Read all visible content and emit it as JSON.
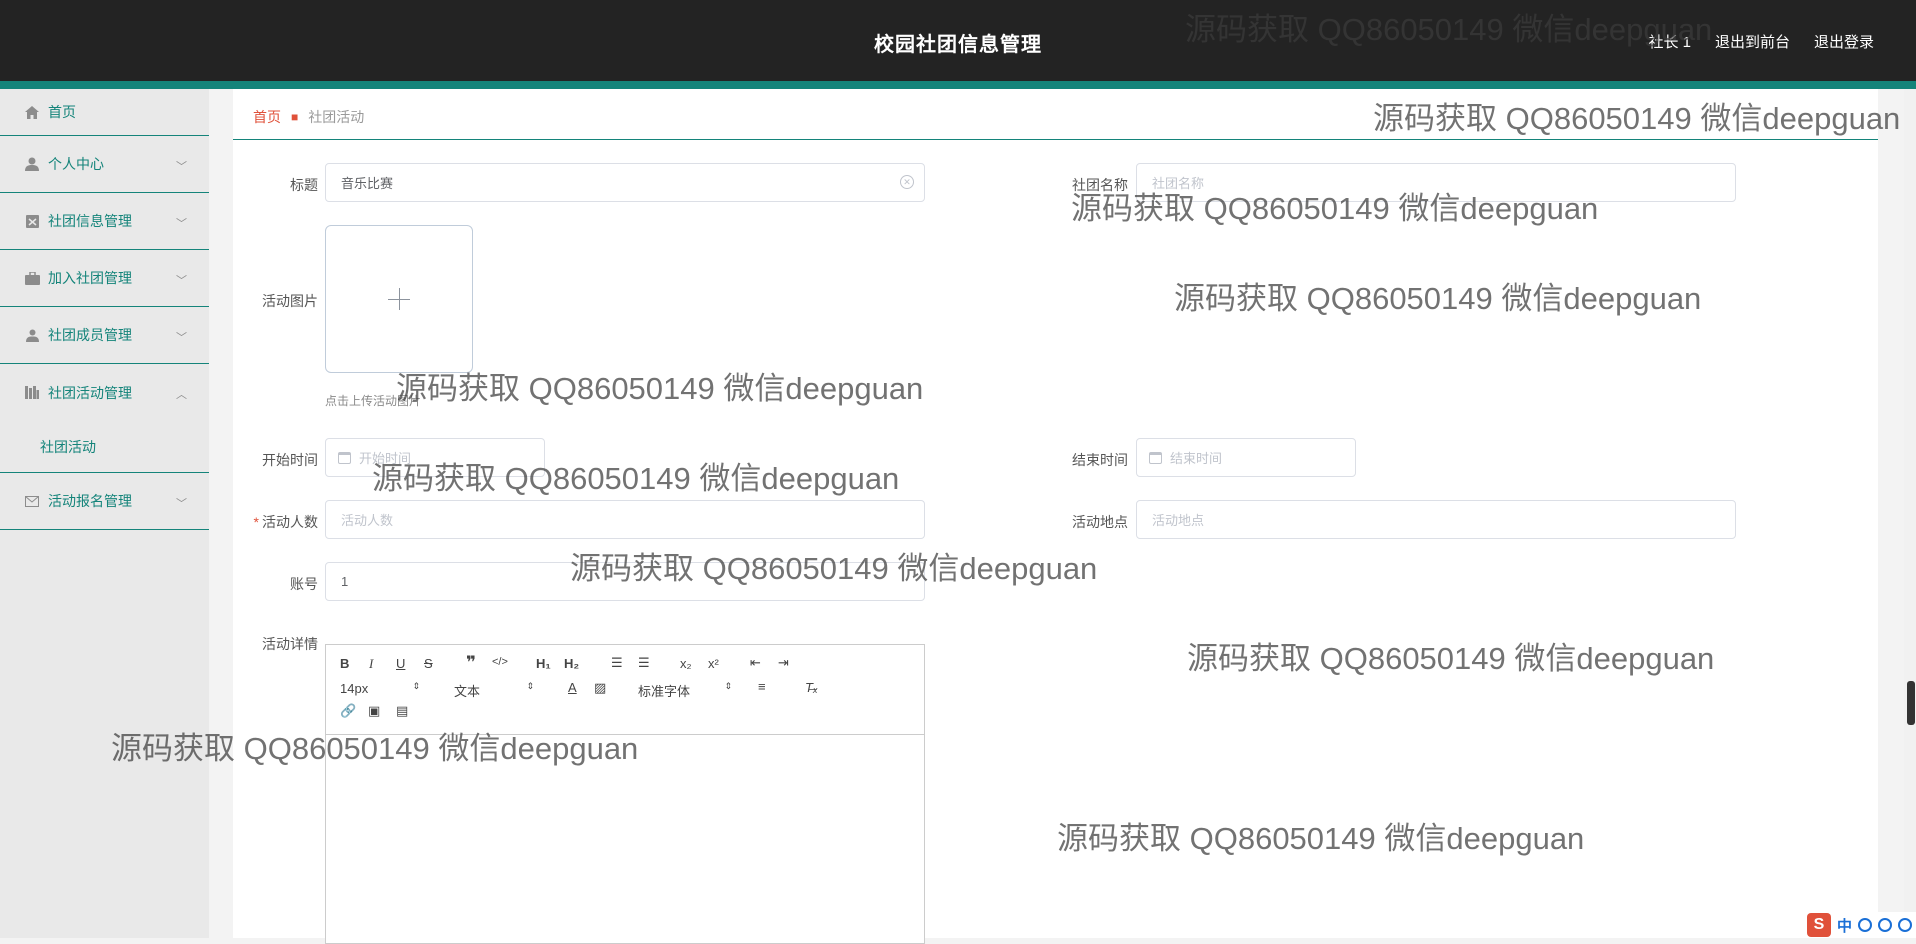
{
  "header": {
    "title": "校园社团信息管理",
    "links": [
      "社长 1",
      "退出到前台",
      "退出登录"
    ]
  },
  "sidebar": {
    "items": [
      {
        "label": "首页",
        "icon": "home-icon"
      },
      {
        "label": "个人中心",
        "icon": "user-icon"
      },
      {
        "label": "社团信息管理",
        "icon": "clipboard-icon"
      },
      {
        "label": "加入社团管理",
        "icon": "briefcase-icon"
      },
      {
        "label": "社团成员管理",
        "icon": "person-icon"
      },
      {
        "label": "社团活动管理",
        "icon": "bars-icon"
      },
      {
        "label": "活动报名管理",
        "icon": "mail-icon"
      }
    ],
    "subitem": "社团活动"
  },
  "breadcrumb": {
    "home": "首页",
    "current": "社团活动"
  },
  "form": {
    "title_label": "标题",
    "title_value": "音乐比赛",
    "club_label": "社团名称",
    "club_placeholder": "社团名称",
    "image_label": "活动图片",
    "image_tip": "点击上传活动图片",
    "start_label": "开始时间",
    "start_placeholder": "开始时间",
    "end_label": "结束时间",
    "end_placeholder": "结束时间",
    "count_label": "活动人数",
    "count_placeholder": "活动人数",
    "place_label": "活动地点",
    "place_placeholder": "活动地点",
    "account_label": "账号",
    "account_value": "1",
    "detail_label": "活动详情"
  },
  "editor": {
    "font_size": "14px",
    "format": "文本",
    "font_family": "标准字体"
  },
  "watermark": "源码获取 QQ86050149 微信deepguan",
  "ime": {
    "lang": "中"
  },
  "colors": {
    "accent": "#14847a",
    "header": "#232323",
    "breadcrumb_home": "#e0513a"
  }
}
